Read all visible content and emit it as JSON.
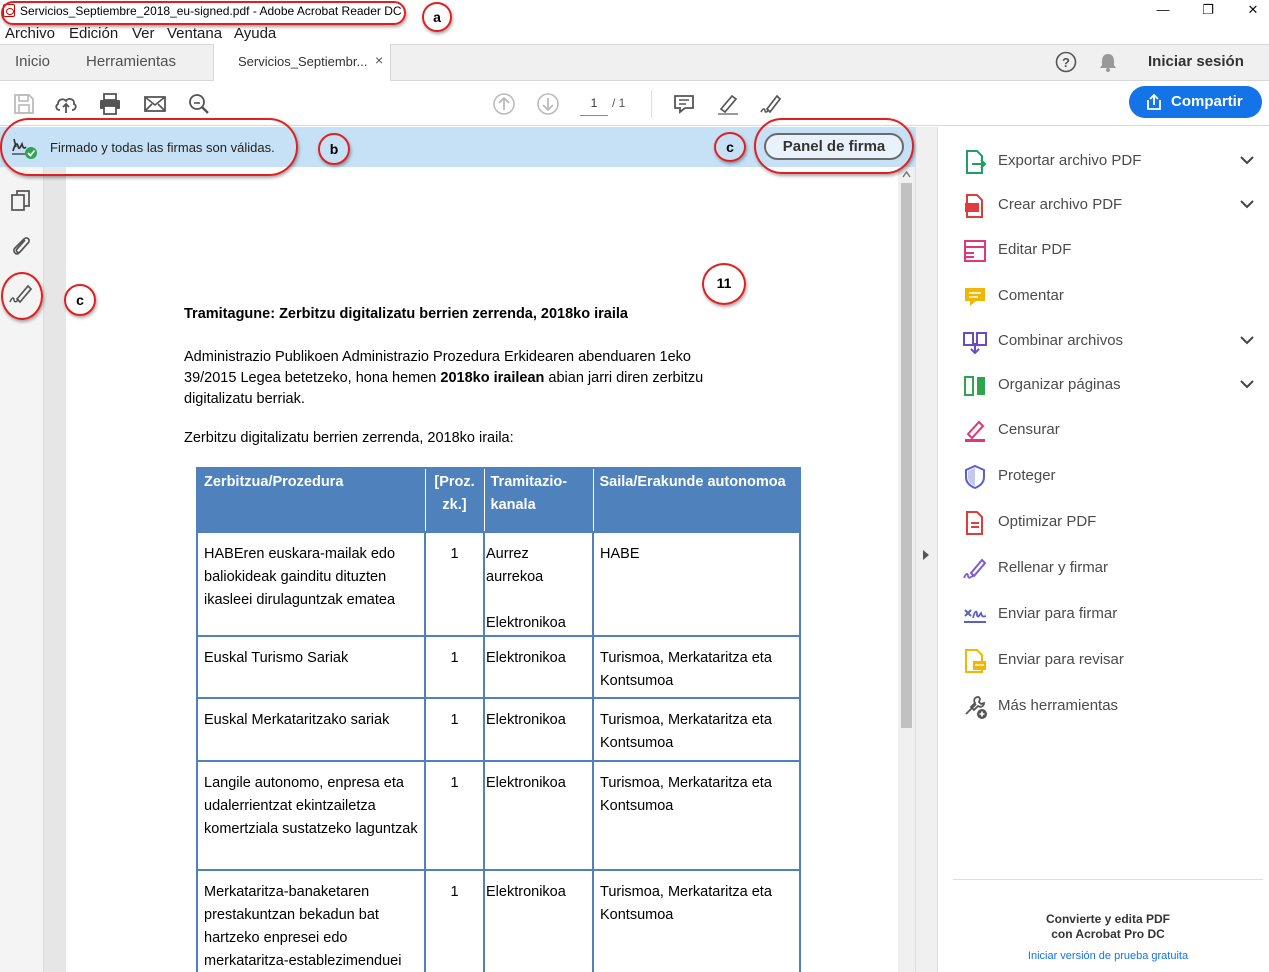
{
  "window": {
    "title": "Servicios_Septiembre_2018_eu-signed.pdf - Adobe Acrobat Reader DC",
    "minimize": "—",
    "restore": "❐",
    "close": "✕"
  },
  "menu": [
    "Archivo",
    "Edición",
    "Ver",
    "Ventana",
    "Ayuda"
  ],
  "tabs": {
    "home": "Inicio",
    "tools": "Herramientas",
    "document": "Servicios_Septiembr...",
    "close": "×"
  },
  "header": {
    "help": "?",
    "signin": "Iniciar sesión"
  },
  "toolbar": {
    "page_current": "1",
    "page_total": "/  1",
    "share_label": "Compartir"
  },
  "signature_bar": {
    "message": "Firmado y todas las firmas son válidas.",
    "panel_button": "Panel de firma"
  },
  "document": {
    "heading": "Tramitagune: Zerbitzu digitalizatu berrien zerrenda, 2018ko iraila",
    "para1_a": "Administrazio Publikoen Administrazio Prozedura Erkidearen abenduaren 1eko",
    "para1_b": "39/2015 Legea betetzeko, hona hemen ",
    "para1_bold": "2018ko irailean",
    "para1_c": " abian jarri diren zerbitzu",
    "para1_d": "digitalizatu berriak.",
    "para2": "Zerbitzu digitalizatu berrien zerrenda, 2018ko iraila:",
    "table_headers": [
      "Zerbitzua/Prozedura",
      "[Proz. zk.]",
      "Tramitazio-kanala",
      "Saila/Erakunde autonomoa"
    ],
    "table_headers_lines": {
      "h2a": "[Proz.",
      "h2b": "zk.]",
      "h3a": "Tramitazio-",
      "h3b": "kanala"
    },
    "rows": [
      {
        "service": "HABEren euskara-mailak edo baliokideak gainditu dituzten ikasleei dirulaguntzak ematea",
        "num": "1",
        "channel_a": "Aurrez aurrekoa",
        "channel_b": "Elektronikoa",
        "dept": "HABE"
      },
      {
        "service": "Euskal Turismo Sariak",
        "num": "1",
        "channel_a": "Elektronikoa",
        "channel_b": "",
        "dept": "Turismoa, Merkataritza eta Kontsumoa"
      },
      {
        "service": "Euskal Merkataritzako sariak",
        "num": "1",
        "channel_a": "Elektronikoa",
        "channel_b": "",
        "dept": "Turismoa, Merkataritza eta Kontsumoa"
      },
      {
        "service": "Langile autonomo, enpresa eta udalerrientzat ekintzailetza komertziala sustatzeko laguntzak",
        "num": "1",
        "channel_a": "Elektronikoa",
        "channel_b": "",
        "dept": "Turismoa, Merkataritza eta Kontsumoa"
      },
      {
        "service": "Merkataritza-banaketaren prestakuntzan bekadun bat hartzeko enpresei edo merkataritza-establezimenduei baimena",
        "num": "1",
        "channel_a": "Elektronikoa",
        "channel_b": "",
        "dept": "Turismoa, Merkataritza eta Kontsumoa"
      }
    ]
  },
  "tools_panel": {
    "items": [
      {
        "label": "Exportar archivo PDF",
        "icon": "export-pdf-icon",
        "color": "#1aa260",
        "chevron": true
      },
      {
        "label": "Crear archivo PDF",
        "icon": "create-pdf-icon",
        "color": "#e03c3c",
        "chevron": true
      },
      {
        "label": "Editar PDF",
        "icon": "edit-pdf-icon",
        "color": "#e0367a",
        "chevron": false
      },
      {
        "label": "Comentar",
        "icon": "comment-icon",
        "color": "#f2b705",
        "chevron": false
      },
      {
        "label": "Combinar archivos",
        "icon": "combine-files-icon",
        "color": "#6a4bc4",
        "chevron": true
      },
      {
        "label": "Organizar páginas",
        "icon": "organize-pages-icon",
        "color": "#2da44e",
        "chevron": true
      },
      {
        "label": "Censurar",
        "icon": "redact-icon",
        "color": "#e0367a",
        "chevron": false
      },
      {
        "label": "Proteger",
        "icon": "protect-icon",
        "color": "#5a5fd0",
        "chevron": false
      },
      {
        "label": "Optimizar PDF",
        "icon": "optimize-pdf-icon",
        "color": "#e03c3c",
        "chevron": false
      },
      {
        "label": "Rellenar y firmar",
        "icon": "fill-sign-icon",
        "color": "#7b5cd6",
        "chevron": false
      },
      {
        "label": "Enviar para firmar",
        "icon": "send-sign-icon",
        "color": "#5a5fd0",
        "chevron": false
      },
      {
        "label": "Enviar para revisar",
        "icon": "send-review-icon",
        "color": "#f2b705",
        "chevron": false
      },
      {
        "label": "Más herramientas",
        "icon": "more-tools-icon",
        "color": "#555555",
        "chevron": false
      }
    ]
  },
  "promo": {
    "line1": "Convierte y edita PDF",
    "line2": "con Acrobat Pro DC",
    "link": "Iniciar versión de prueba gratuita"
  },
  "annotations": {
    "a": "a",
    "b": "b",
    "c1": "c",
    "c2": "c",
    "n11": "11"
  }
}
